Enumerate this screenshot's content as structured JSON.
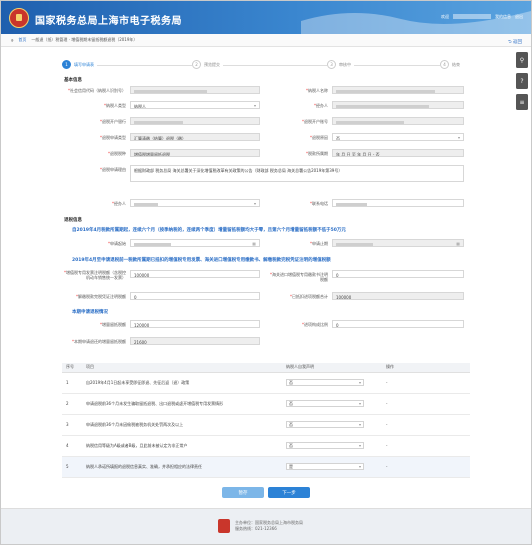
{
  "header": {
    "site_title": "国家税务总局上海市电子税务局",
    "user_links": [
      "欢迎",
      "我的信息",
      "退出"
    ]
  },
  "breadcrumb": {
    "home": "首页",
    "path": "一般退（抵）税管理 · 增值税期末留抵税额退税（2019年）",
    "back": "返回"
  },
  "float_icons": [
    "search-icon",
    "help-icon",
    "document-icon"
  ],
  "steps": [
    "填写申请表",
    "预览提交",
    "审核中",
    "结束"
  ],
  "sections": {
    "basic_info": "基本信息",
    "refund_info": "退税信息",
    "cond1": "自2019年4月税款所属期起，连续六个月（按季纳税的，连续两个季度）增量留抵税额均大于零，且第六个月增量留抵税额不低于50万元",
    "cond2": "2019年4月至申请退税前一税款所属期已抵扣的增值税专用发票、海关进口增值税专用缴款书、解缴税款完税凭证注明的增值税额",
    "cond3": "本期申请退税情况"
  },
  "fields": {
    "taxpayer_id": "社会信用代码（纳税人识别号）",
    "taxpayer_name": "纳税人名称",
    "applicant_type": "纳税人类型",
    "applicant_type_value": "纳税人",
    "agent": "经办人",
    "bank_name": "退税开户银行",
    "bank_account": "退税开户账号",
    "refund_type": "退税申请类型",
    "refund_type_value": "汇算清缴（结算）退税（缴）",
    "refund_reason": "退税原因",
    "refund_reason_value": "否",
    "tax_item": "退税税种",
    "tax_item_value": "增值税增量留抵退税",
    "period": "税款所属期",
    "period_value": "年 月 日 至 年 月 日 - 否",
    "basis": "退税申请理由",
    "basis_value": "根据财政部 税务总局 海关总署关于深化增值税改革有关政策的公告（财政部 税务总局 海关总署公告2019年第39号）",
    "handler": "经办人",
    "handler_value": "经办人",
    "phone": "联系电话",
    "apply_start": "申请起始",
    "apply_end": "申请止期",
    "vat_amount": "增值税专用发票注明税额（含税控机动车销售统一发票）",
    "vat_amount_value": "100000",
    "customs": "海关进口增值税专用缴款书注明税额",
    "customs_value": "0",
    "levy": "解缴税款完税凭证注明税额",
    "levy_value": "0",
    "total_input": "已抵扣进项税额合计",
    "total_input_value": "100000",
    "incremental": "增量留抵税额",
    "incremental_value": "120000",
    "ratio": "进项构成比例",
    "ratio_value": "0",
    "refund_amount": "本期申请退还的增量留抵税额",
    "refund_amount_value": "21600"
  },
  "table": {
    "headers": [
      "序号",
      "项目",
      "纳税人自我声明",
      "操作"
    ],
    "rows": [
      {
        "no": "1",
        "item": "自2019年4月1日起未享受即征即退、先征后返（退）政策",
        "value": "否"
      },
      {
        "no": "2",
        "item": "申请退税前36个月未发生骗取留抵退税、出口退税或虚开增值税专用发票情形",
        "value": "否"
      },
      {
        "no": "3",
        "item": "申请退税前36个月未因偷税被税务机关处罚两次及以上",
        "value": "否"
      },
      {
        "no": "4",
        "item": "纳税信用等级为A级或者B级，且此前未被认定为非正常户",
        "value": "否"
      },
      {
        "no": "5",
        "item": "纳税人承诺所填报的退税信息真实、准确，并承担相应的法律责任",
        "value": "是"
      }
    ]
  },
  "buttons": {
    "prev": "暂存",
    "next": "下一步"
  },
  "footer": {
    "line1": "主办单位：国家税务总局上海市税务局",
    "line2": "服务热线：021-12366"
  },
  "colors": {
    "primary": "#2c82d6",
    "header": "#1f5fae"
  }
}
